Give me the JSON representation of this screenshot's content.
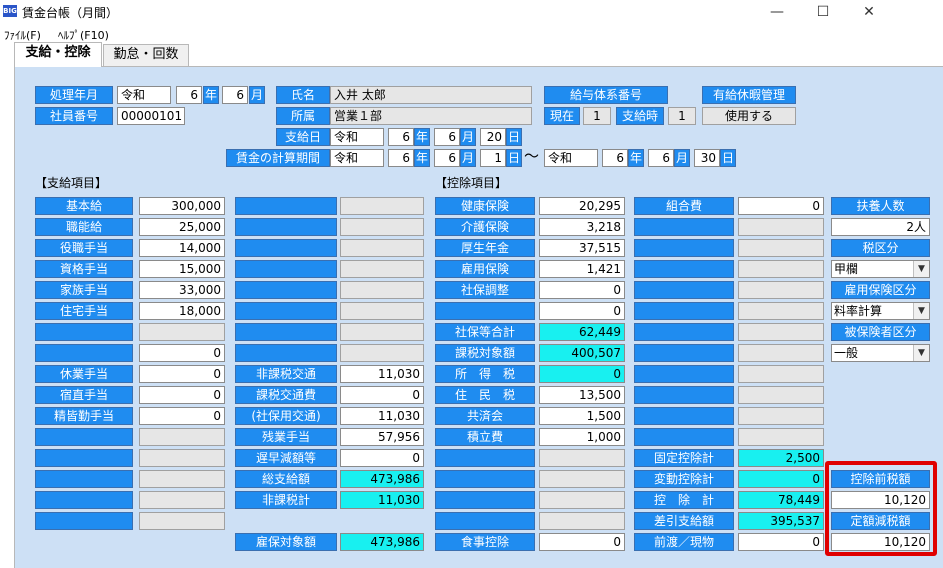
{
  "window": {
    "icon": "BIG",
    "title": "賃金台帳（月間）",
    "minimize": "—",
    "maximize": "☐",
    "close": "✕"
  },
  "menu": {
    "file": "ﾌｧｲﾙ(F)",
    "help": "ﾍﾙﾌﾟ(F10)"
  },
  "tabs": {
    "pay": "支給・控除",
    "attendance": "勤怠・回数"
  },
  "header": {
    "period_label": "処理年月",
    "era": "令和",
    "year": "6",
    "year_unit": "年",
    "month": "6",
    "month_unit": "月",
    "name_label": "氏名",
    "name": "入井 太郎",
    "emp_no_label": "社員番号",
    "emp_no": "00000101",
    "dept_label": "所属",
    "dept": "営業１部",
    "payday_label": "支給日",
    "payday_era": "令和",
    "payday_year": "6",
    "payday_month": "6",
    "payday_day": "20",
    "day_unit": "日",
    "calc_label": "賃金の計算期間",
    "from_era": "令和",
    "from_year": "6",
    "from_month": "6",
    "from_day": "1",
    "tilde": "～",
    "to_era": "令和",
    "to_year": "6",
    "to_month": "6",
    "to_day": "30",
    "pay_system_label": "給与体系番号",
    "current_label": "現在",
    "current_value": "1",
    "at_pay_label": "支給時",
    "at_pay_value": "1",
    "leave_label": "有給休暇管理",
    "leave_value": "使用する"
  },
  "sections": {
    "payments": "【支給項目】",
    "deductions": "【控除項目】"
  },
  "payments": {
    "basic_label": "基本給",
    "basic": "300,000",
    "skill_label": "職能給",
    "skill": "25,000",
    "position_label": "役職手当",
    "position": "14,000",
    "qualification_label": "資格手当",
    "qualification": "15,000",
    "family_label": "家族手当",
    "family": "33,000",
    "housing_label": "住宅手当",
    "housing": "18,000",
    "blank_value": "0",
    "holiday_label": "休業手当",
    "holiday": "0",
    "night_label": "宿直手当",
    "night": "0",
    "attendance_label": "精皆勤手当",
    "attendance": "0",
    "nontax_commute_label": "非課税交通",
    "nontax_commute": "11,030",
    "tax_commute_label": "課税交通費",
    "tax_commute": "0",
    "social_commute_label": "(社保用交通)",
    "social_commute": "11,030",
    "overtime_label": "残業手当",
    "overtime": "57,956",
    "late_label": "遅早減額等",
    "late": "0",
    "total_label": "総支給額",
    "total": "473,986",
    "nontax_total_label": "非課税計",
    "nontax_total": "11,030",
    "employment_ins_label": "雇保対象額",
    "employment_ins": "473,986"
  },
  "deductions": {
    "health_label": "健康保険",
    "health": "20,295",
    "care_label": "介護保険",
    "care": "3,218",
    "pension_label": "厚生年金",
    "pension": "37,515",
    "employment_label": "雇用保険",
    "employment": "1,421",
    "adjust_label": "社保調整",
    "adjust": "0",
    "blank_value": "0",
    "social_total_label": "社保等合計",
    "social_total": "62,449",
    "taxable_label": "課税対象額",
    "taxable": "400,507",
    "income_tax_label": "所　得　税",
    "income_tax": "0",
    "resident_tax_label": "住　民　税",
    "resident_tax": "13,500",
    "mutual_label": "共済会",
    "mutual": "1,500",
    "savings_label": "積立費",
    "savings": "1,000",
    "meal_label": "食事控除",
    "meal": "0",
    "union_label": "組合費",
    "union": "0",
    "fixed_label": "固定控除計",
    "fixed": "2,500",
    "variable_label": "変動控除計",
    "variable": "0",
    "deduction_total_label": "控　除　計",
    "deduction_total": "78,449",
    "net_label": "差引支給額",
    "net": "395,537",
    "in_kind_label": "前渡／現物",
    "in_kind": "0"
  },
  "right": {
    "dependents_label": "扶養人数",
    "dependents": "2人",
    "tax_class_label": "税区分",
    "tax_class": "甲欄",
    "emp_ins_class_label": "雇用保険区分",
    "emp_ins_class": "料率計算",
    "insured_class_label": "被保険者区分",
    "insured_class": "一般",
    "pretax_label": "控除前税額",
    "pretax": "10,120",
    "flat_reduction_label": "定額減税額",
    "flat_reduction": "10,120"
  },
  "colors": {
    "label_blue": "#1f8cf0",
    "panel": "#cde0f5",
    "cyan": "#18f0f0",
    "highlight": "#e00000"
  },
  "icons": {
    "dropdown": "chevron-down-icon",
    "app": "app-icon"
  }
}
